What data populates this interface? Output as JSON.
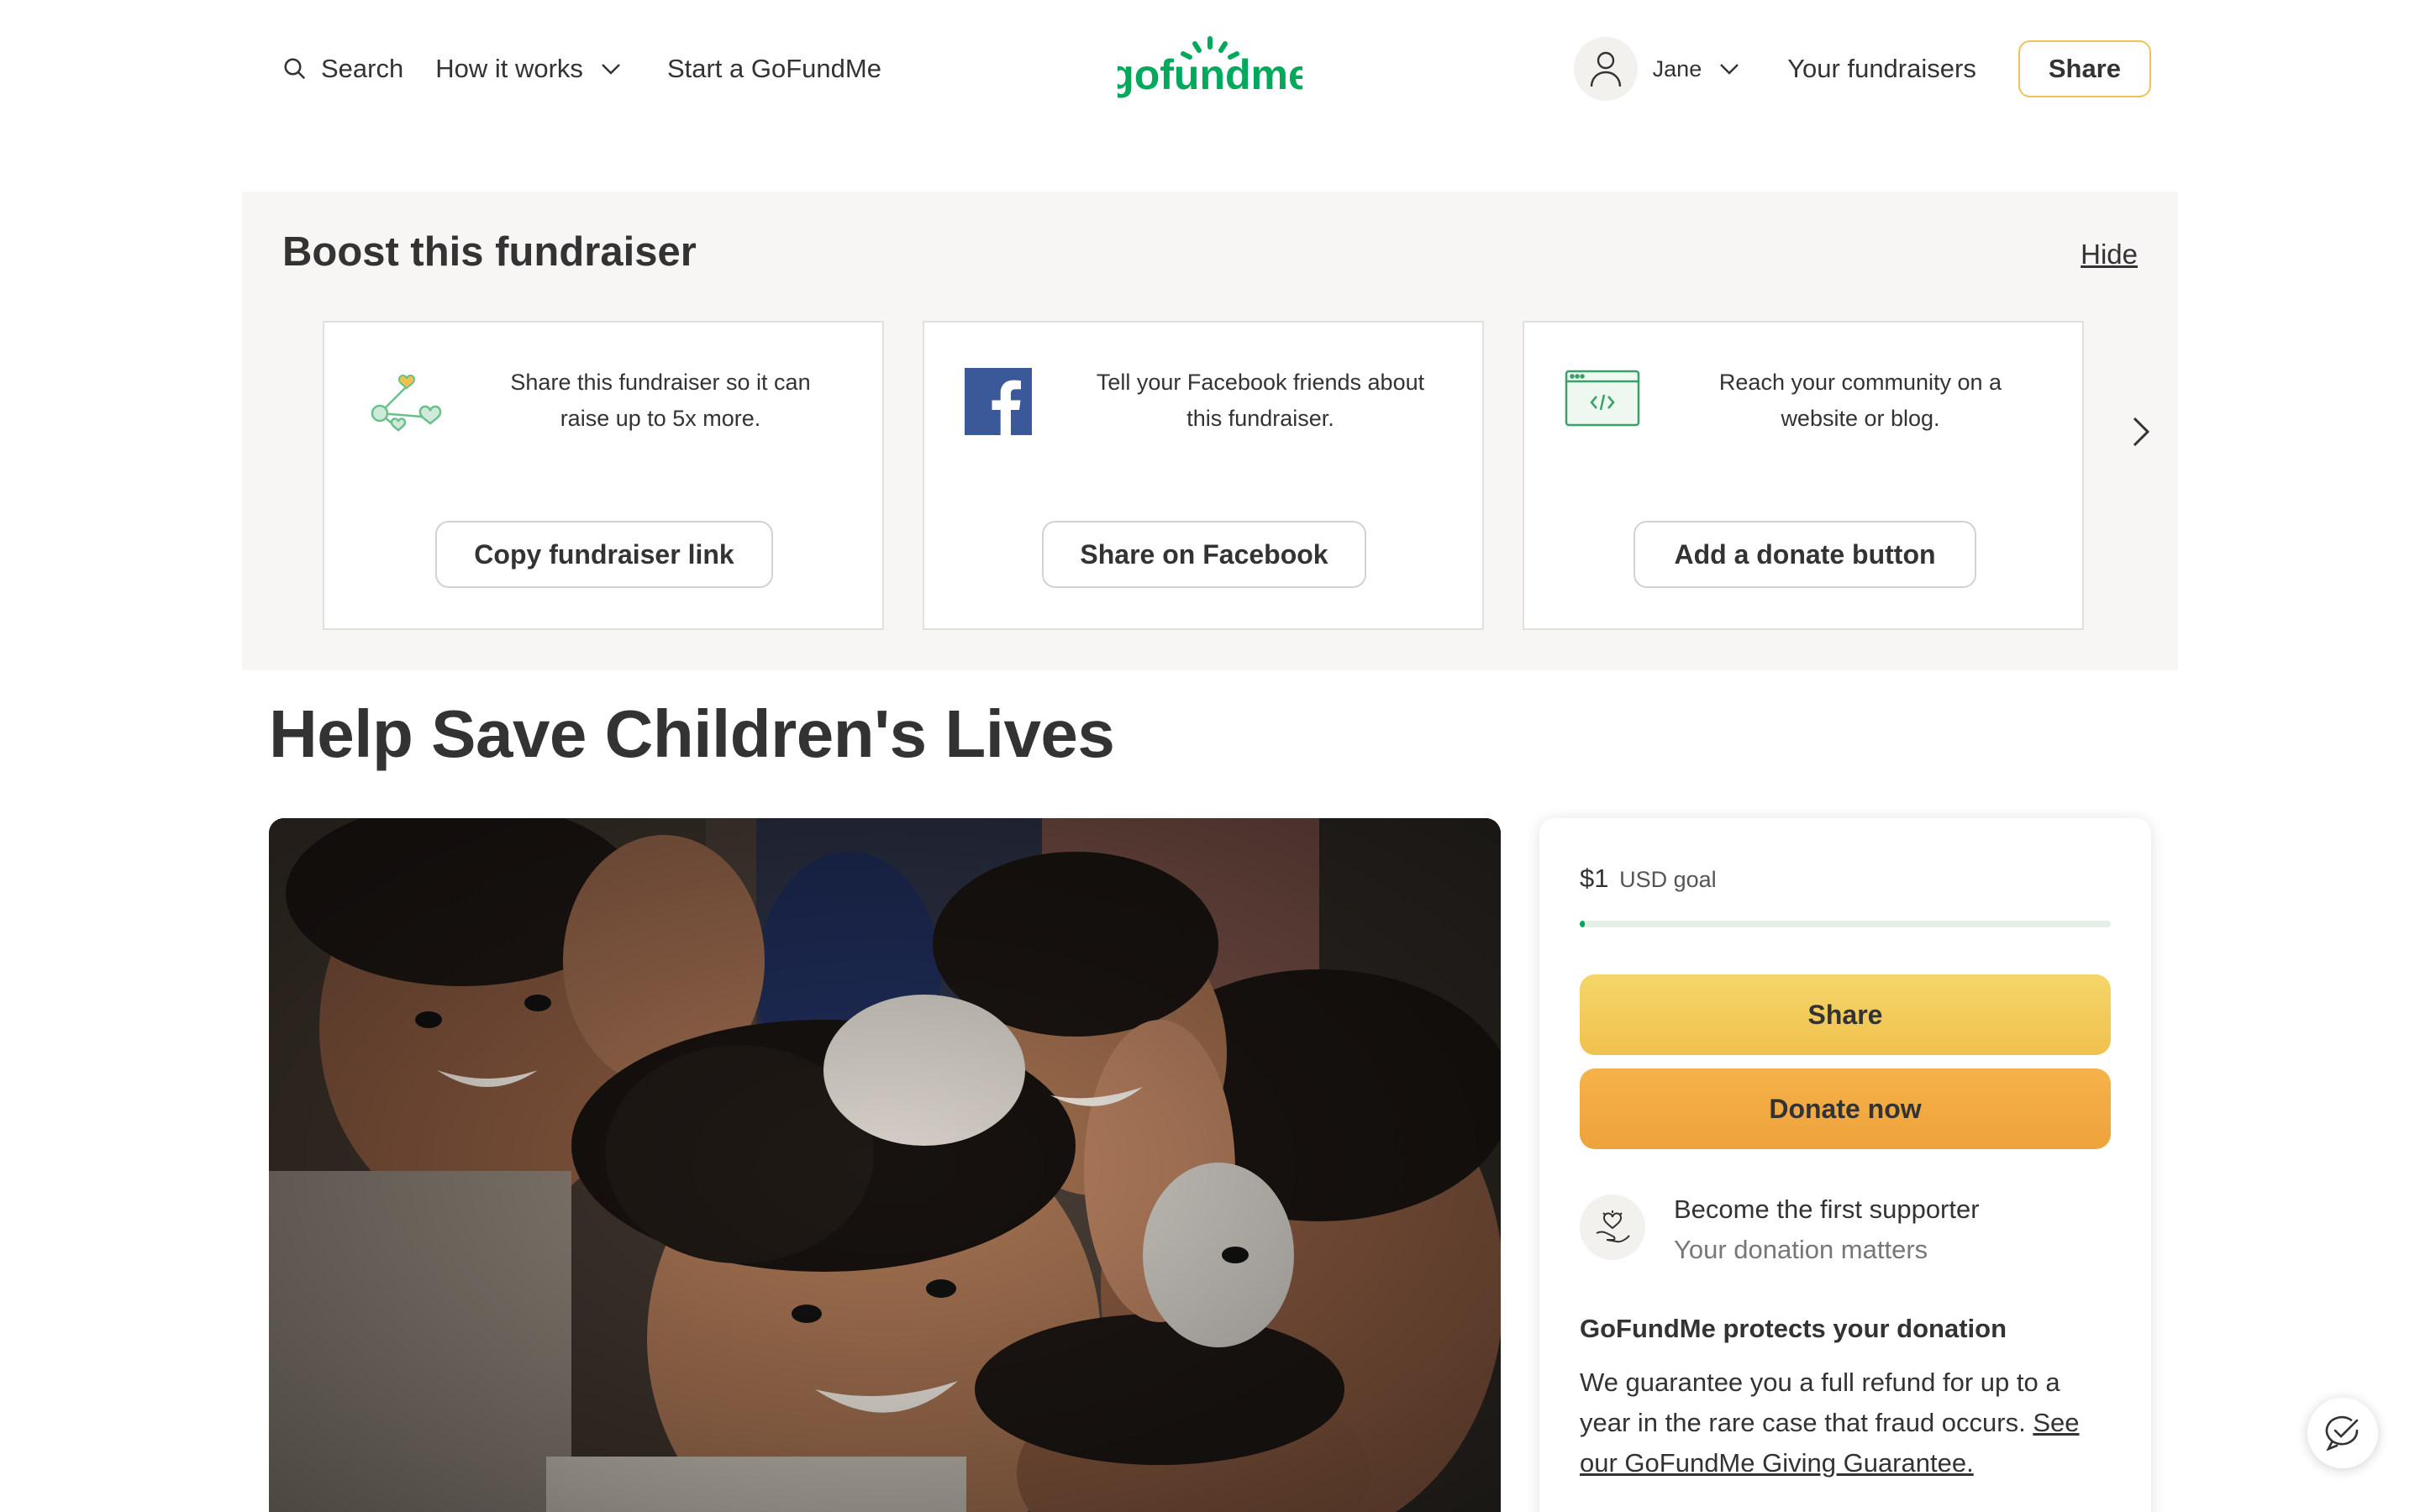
{
  "header": {
    "search_label": "Search",
    "how_it_works_label": "How it works",
    "start_label": "Start a GoFundMe",
    "logo_text": "gofundme",
    "user_name": "Jane",
    "your_fundraisers_label": "Your fundraisers",
    "share_label": "Share"
  },
  "boost": {
    "title": "Boost this fundraiser",
    "hide_label": "Hide",
    "cards": [
      {
        "icon": "share-hearts-icon",
        "text": "Share this fundraiser so it can raise up to 5x more.",
        "button": "Copy fundraiser link"
      },
      {
        "icon": "facebook-icon",
        "text": "Tell your Facebook friends about this fundraiser.",
        "button": "Share on Facebook"
      },
      {
        "icon": "code-embed-icon",
        "text": "Reach your community on a website or blog.",
        "button": "Add a donate button"
      }
    ]
  },
  "fundraiser": {
    "title": "Help Save Children's Lives"
  },
  "donation": {
    "goal_amount": "$1",
    "goal_label": "USD goal",
    "progress_fraction": 0.01,
    "share_label": "Share",
    "donate_label": "Donate now",
    "supporter_title": "Become the first supporter",
    "supporter_subtitle": "Your donation matters",
    "protect_title": "GoFundMe protects your donation",
    "protect_text": "We guarantee you a full refund for up to a year in the rare case that fraud occurs. ",
    "protect_link": "See our GoFundMe Giving Guarantee."
  },
  "colors": {
    "brand_green": "#02a95c",
    "share_yellow": "#f0c14d",
    "donate_orange": "#eea23a",
    "panel_bg": "#f7f6f4"
  }
}
